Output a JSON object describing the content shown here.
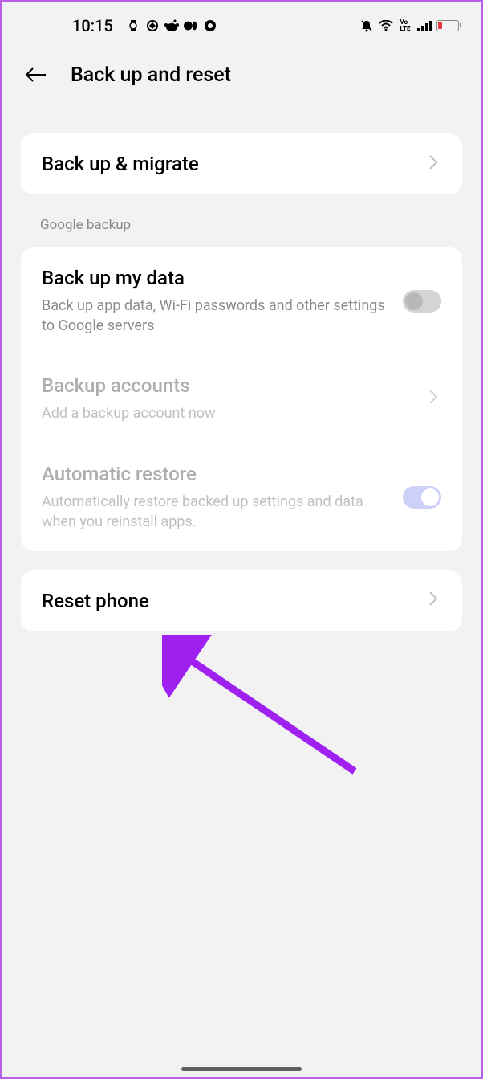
{
  "statusBar": {
    "time": "10:15"
  },
  "header": {
    "title": "Back up and reset"
  },
  "backupMigrate": {
    "title": "Back up & migrate"
  },
  "sectionGoogle": {
    "label": "Google backup"
  },
  "backupMyData": {
    "title": "Back up my data",
    "subtitle": "Back up app data, Wi-Fi passwords and other settings to Google servers"
  },
  "backupAccounts": {
    "title": "Backup accounts",
    "subtitle": "Add a backup account now"
  },
  "automaticRestore": {
    "title": "Automatic restore",
    "subtitle": "Automatically restore backed up settings and data when you reinstall apps."
  },
  "resetPhone": {
    "title": "Reset phone"
  }
}
